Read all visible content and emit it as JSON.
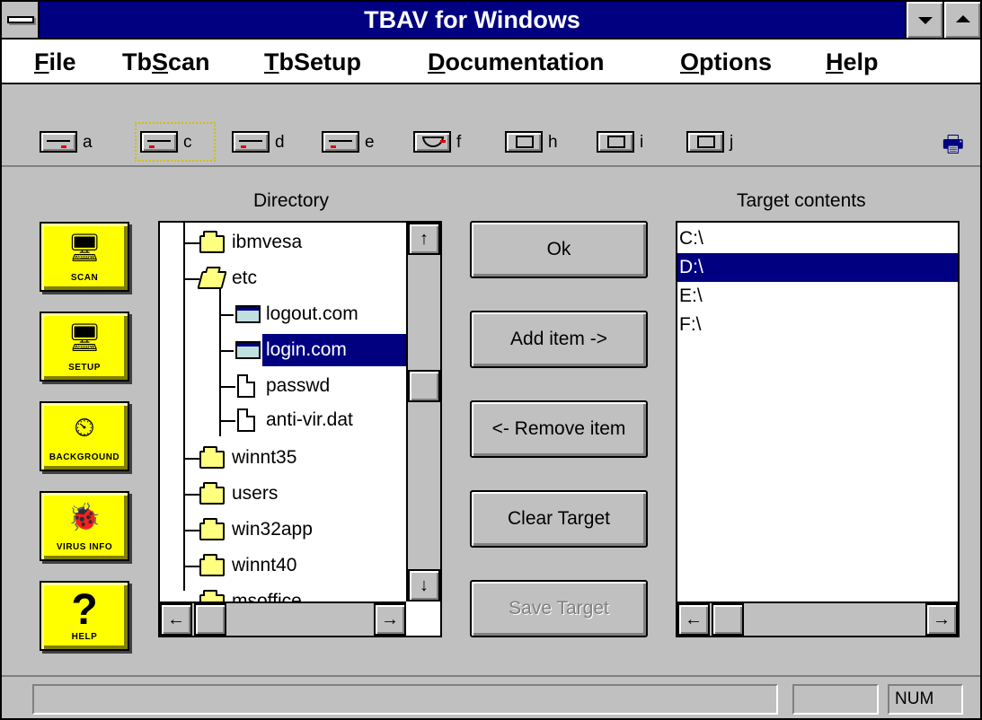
{
  "window": {
    "title": "TBAV for Windows"
  },
  "menu": [
    {
      "pre": "",
      "key": "F",
      "post": "ile"
    },
    {
      "pre": "Tb",
      "key": "S",
      "post": "can"
    },
    {
      "pre": "",
      "key": "T",
      "post": "bSetup"
    },
    {
      "pre": "",
      "key": "D",
      "post": "ocumentation"
    },
    {
      "pre": "",
      "key": "O",
      "post": "ptions"
    },
    {
      "pre": "",
      "key": "H",
      "post": "elp"
    }
  ],
  "drives": [
    {
      "letter": "a",
      "type": "floppy-drive-icon"
    },
    {
      "letter": "c",
      "type": "hard-drive-icon",
      "selected": true
    },
    {
      "letter": "d",
      "type": "hard-drive-icon"
    },
    {
      "letter": "e",
      "type": "hard-drive-icon"
    },
    {
      "letter": "f",
      "type": "cdrom-drive-icon"
    },
    {
      "letter": "h",
      "type": "network-drive-icon"
    },
    {
      "letter": "i",
      "type": "network-drive-icon"
    },
    {
      "letter": "j",
      "type": "network-drive-icon"
    }
  ],
  "labels": {
    "directory": "Directory",
    "target": "Target contents"
  },
  "side_buttons": [
    {
      "caption": "SCAN",
      "icon": "scan-computer-icon",
      "glyph": "🖥"
    },
    {
      "caption": "SETUP",
      "icon": "setup-computer-icon",
      "glyph": "🖥"
    },
    {
      "caption": "BACKGROUND",
      "icon": "background-clock-icon",
      "glyph": "⏲"
    },
    {
      "caption": "VIRUS INFO",
      "icon": "virus-bug-icon",
      "glyph": "🐞"
    },
    {
      "caption": "HELP",
      "icon": "help-question-icon",
      "glyph": "?"
    }
  ],
  "tree": [
    {
      "name": "ibmvesa",
      "kind": "folder",
      "level": 0
    },
    {
      "name": "etc",
      "kind": "folder-open",
      "level": 0
    },
    {
      "name": "logout.com",
      "kind": "exe",
      "level": 1
    },
    {
      "name": "login.com",
      "kind": "exe",
      "level": 1,
      "selected": true
    },
    {
      "name": "passwd",
      "kind": "doc",
      "level": 1
    },
    {
      "name": "anti-vir.dat",
      "kind": "doc",
      "level": 1
    },
    {
      "name": "winnt35",
      "kind": "folder",
      "level": 0
    },
    {
      "name": "users",
      "kind": "folder",
      "level": 0
    },
    {
      "name": "win32app",
      "kind": "folder",
      "level": 0
    },
    {
      "name": "winnt40",
      "kind": "folder",
      "level": 0
    },
    {
      "name": "msoffice",
      "kind": "folder",
      "level": 0
    }
  ],
  "buttons": {
    "ok": "Ok",
    "add": "Add item ->",
    "remove": "<- Remove item",
    "clear": "Clear Target",
    "save": "Save Target"
  },
  "targets": [
    {
      "name": "C:\\"
    },
    {
      "name": "D:\\",
      "selected": true
    },
    {
      "name": "E:\\"
    },
    {
      "name": "F:\\"
    }
  ],
  "status": {
    "num": "NUM"
  }
}
